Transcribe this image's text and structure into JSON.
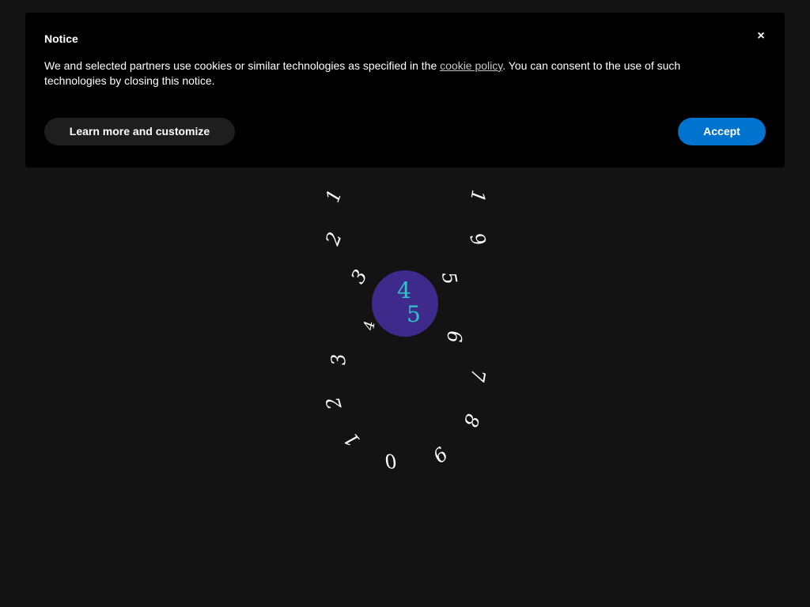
{
  "notice": {
    "title": "Notice",
    "close_label": "×",
    "text_before_link": "We and selected partners use cookies or similar technologies as specified in the ",
    "link_text": "cookie policy",
    "text_after_link": ". You can consent to the use of such technologies by closing this notice.",
    "learn_more_label": "Learn more and customize",
    "accept_label": "Accept",
    "accept_color": "#0073ce"
  },
  "spiral": {
    "digits": [
      "1",
      "2",
      "3",
      "4",
      "3",
      "2",
      "1",
      "0",
      "9",
      "8",
      "7",
      "6",
      "5",
      "9",
      "1"
    ],
    "center_digits": [
      "4",
      "5"
    ],
    "center_color": "#3d2a8a",
    "center_digit_color": "#2fc5c9"
  }
}
